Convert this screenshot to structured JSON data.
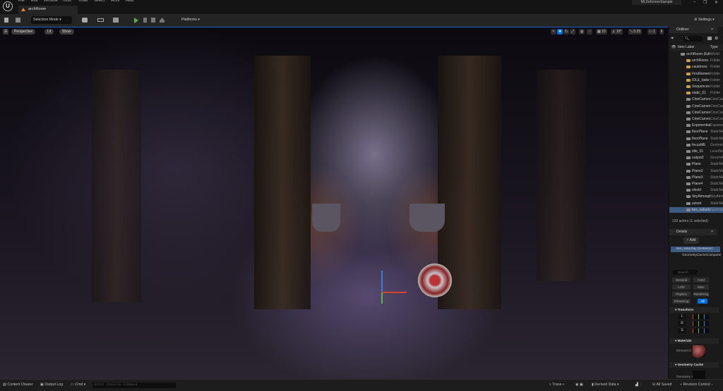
{
  "menu": [
    "File",
    "Edit",
    "Window",
    "Tools",
    "Build",
    "Select",
    "Actor",
    "Help"
  ],
  "level_tab": "archRoom",
  "project_name": "MLDeformerSample",
  "window_controls": {
    "minimize": "–",
    "maximize": "❐",
    "close": "✕"
  },
  "toolbar": {
    "selection_mode": "Selection Mode",
    "platforms": "Platforms",
    "settings": "Settings"
  },
  "viewport": {
    "perspective": "Perspective",
    "lit": "Lit",
    "show": "Show",
    "grid_snap": "10",
    "rotation_snap": "10°",
    "scale_snap": "0.25",
    "camera_speed": "1"
  },
  "outliner": {
    "title": "Outliner",
    "col_label": "Item Label",
    "col_type": "Type",
    "status": "133 actors (1 selected)",
    "items": [
      {
        "label": "archRoom (Editor)",
        "type": "World",
        "icon": "world",
        "indent": 0
      },
      {
        "label": "archRoom",
        "type": "Folder",
        "icon": "folder"
      },
      {
        "label": "cauldrons",
        "type": "Folder",
        "icon": "folder"
      },
      {
        "label": "FireElements",
        "type": "Folder",
        "icon": "folder"
      },
      {
        "label": "IDLE_bake",
        "type": "Folder",
        "icon": "folder"
      },
      {
        "label": "Sequences",
        "type": "Folder",
        "icon": "folder"
      },
      {
        "label": "static_01",
        "type": "Folder",
        "icon": "folder"
      },
      {
        "label": "CineCamera",
        "type": "CineCameraActor",
        "icon": "camera"
      },
      {
        "label": "CineCamera",
        "type": "CineCameraActor",
        "icon": "camera"
      },
      {
        "label": "CineCamera",
        "type": "CineCameraActor",
        "icon": "camera"
      },
      {
        "label": "CineCamera",
        "type": "CineCameraActor",
        "icon": "camera"
      },
      {
        "label": "ExponentialHeightFog",
        "type": "ExponentialHeightFog",
        "icon": "fog"
      },
      {
        "label": "floorPlane",
        "type": "StaticMeshActor",
        "icon": "mesh"
      },
      {
        "label": "floorPlane",
        "type": "StaticMeshActor",
        "icon": "mesh"
      },
      {
        "label": "focusME",
        "type": "GeometryCacheActor",
        "icon": "mesh"
      },
      {
        "label": "idle_01",
        "type": "LevelSequenceActor",
        "icon": "sequence"
      },
      {
        "label": "output2",
        "type": "GroomActor",
        "icon": "groom"
      },
      {
        "label": "Plane",
        "type": "StaticMeshActor",
        "icon": "mesh"
      },
      {
        "label": "Plane2",
        "type": "StaticMeshActor",
        "icon": "mesh"
      },
      {
        "label": "Plane3",
        "type": "StaticMeshActor",
        "icon": "mesh"
      },
      {
        "label": "Plane4",
        "type": "StaticMeshActor",
        "icon": "mesh"
      },
      {
        "label": "shield",
        "type": "StaticMeshActor",
        "icon": "mesh"
      },
      {
        "label": "SkyAtmosphere",
        "type": "SkyAtmosphere",
        "icon": "sky"
      },
      {
        "label": "sword",
        "type": "StaticMeshActor",
        "icon": "mesh"
      },
      {
        "label": "ties_saturday",
        "type": "GeometryCacheActor",
        "icon": "mesh",
        "selected": true
      }
    ]
  },
  "details": {
    "title": "Details",
    "add": "Add",
    "selected_actor": "ties_saturday (Instance)",
    "component": "GeometryCacheComponent",
    "search_placeholder": "Search",
    "categories": [
      "General",
      "Actor",
      "LOD",
      "Misc",
      "Physics",
      "Rendering",
      "Streaming",
      "All"
    ],
    "active_category": "All",
    "sections": {
      "transform": "Transform",
      "materials": "Materials",
      "geometry_cache": "Geometry Cache"
    },
    "transform_rows": [
      "L",
      "R",
      "S"
    ],
    "element_label": "Element 0",
    "geometry_label": "Geometry Cache"
  },
  "bottom": {
    "content_drawer": "Content Drawer",
    "output_log": "Output Log",
    "cmd": "Cmd",
    "console_placeholder": "Enter Console Command",
    "trace": "Trace",
    "derived_data": "Derived Data",
    "all_saved": "All Saved",
    "revision_control": "Revision Control"
  },
  "colors": {
    "accent": "#0070e0",
    "play": "#5bb548",
    "selection": "#3d5a80"
  }
}
